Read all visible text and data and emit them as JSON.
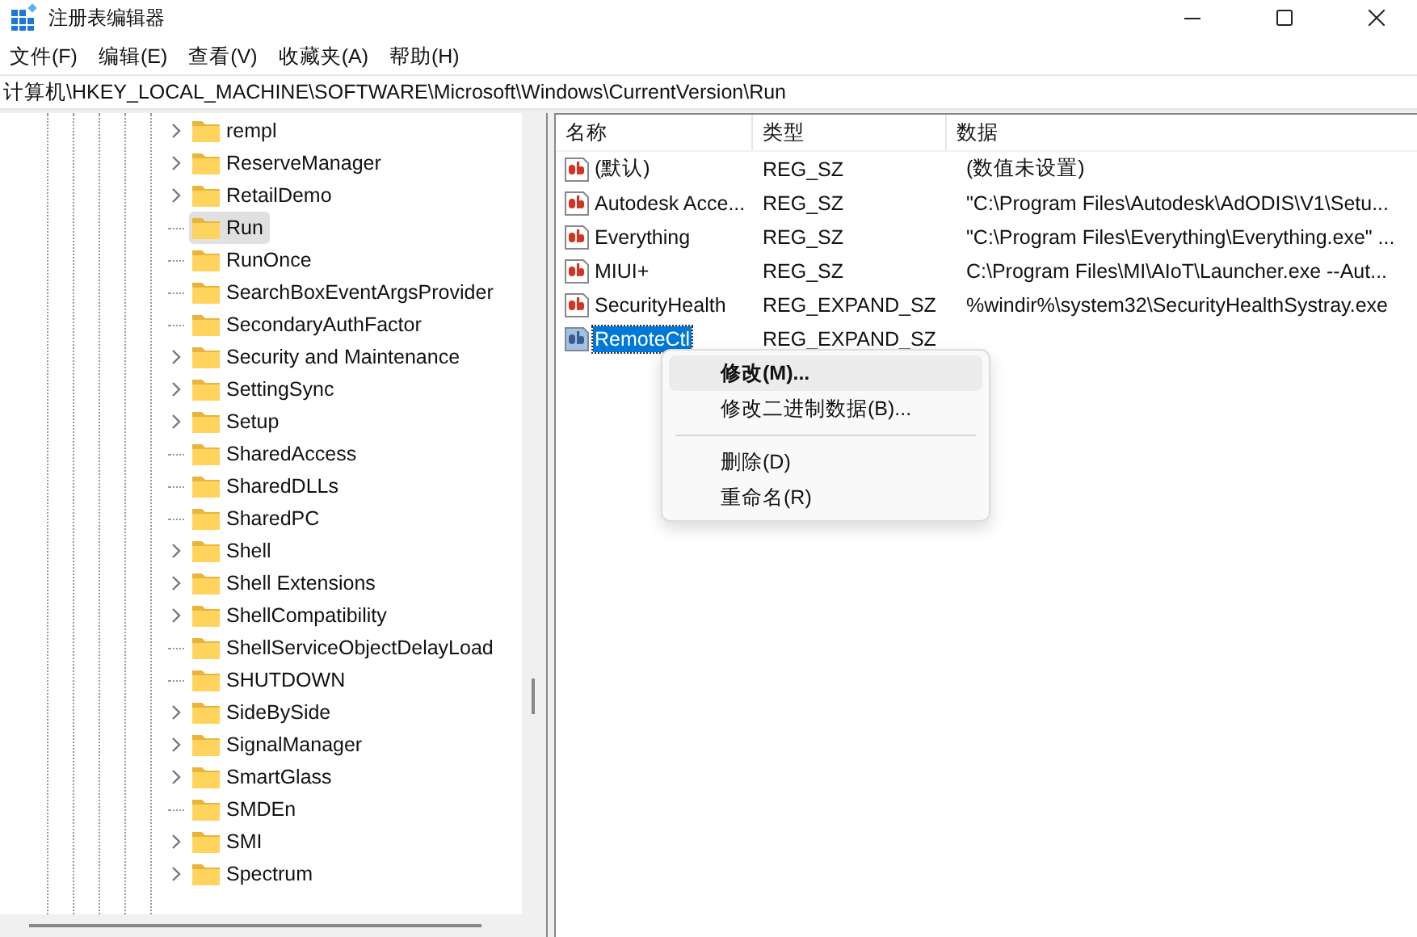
{
  "window": {
    "title": "注册表编辑器"
  },
  "menu": [
    "文件(F)",
    "编辑(E)",
    "查看(V)",
    "收藏夹(A)",
    "帮助(H)"
  ],
  "address": "计算机\\HKEY_LOCAL_MACHINE\\SOFTWARE\\Microsoft\\Windows\\CurrentVersion\\Run",
  "tree": [
    {
      "label": "rempl",
      "has_children": true,
      "selected": false
    },
    {
      "label": "ReserveManager",
      "has_children": true,
      "selected": false
    },
    {
      "label": "RetailDemo",
      "has_children": true,
      "selected": false
    },
    {
      "label": "Run",
      "has_children": false,
      "selected": true
    },
    {
      "label": "RunOnce",
      "has_children": false,
      "selected": false
    },
    {
      "label": "SearchBoxEventArgsProvider",
      "has_children": false,
      "selected": false
    },
    {
      "label": "SecondaryAuthFactor",
      "has_children": false,
      "selected": false
    },
    {
      "label": "Security and Maintenance",
      "has_children": true,
      "selected": false
    },
    {
      "label": "SettingSync",
      "has_children": true,
      "selected": false
    },
    {
      "label": "Setup",
      "has_children": true,
      "selected": false
    },
    {
      "label": "SharedAccess",
      "has_children": false,
      "selected": false
    },
    {
      "label": "SharedDLLs",
      "has_children": false,
      "selected": false
    },
    {
      "label": "SharedPC",
      "has_children": false,
      "selected": false
    },
    {
      "label": "Shell",
      "has_children": true,
      "selected": false
    },
    {
      "label": "Shell Extensions",
      "has_children": true,
      "selected": false
    },
    {
      "label": "ShellCompatibility",
      "has_children": true,
      "selected": false
    },
    {
      "label": "ShellServiceObjectDelayLoad",
      "has_children": false,
      "selected": false
    },
    {
      "label": "SHUTDOWN",
      "has_children": false,
      "selected": false
    },
    {
      "label": "SideBySide",
      "has_children": true,
      "selected": false
    },
    {
      "label": "SignalManager",
      "has_children": true,
      "selected": false
    },
    {
      "label": "SmartGlass",
      "has_children": true,
      "selected": false
    },
    {
      "label": "SMDEn",
      "has_children": false,
      "selected": false
    },
    {
      "label": "SMI",
      "has_children": true,
      "selected": false
    },
    {
      "label": "Spectrum",
      "has_children": true,
      "selected": false
    }
  ],
  "table": {
    "columns": [
      "名称",
      "类型",
      "数据"
    ],
    "rows": [
      {
        "name": "(默认)",
        "type": "REG_SZ",
        "data": "(数值未设置)",
        "selected": false
      },
      {
        "name": "Autodesk Acce...",
        "type": "REG_SZ",
        "data": "\"C:\\Program Files\\Autodesk\\AdODIS\\V1\\Setu...",
        "selected": false
      },
      {
        "name": "Everything",
        "type": "REG_SZ",
        "data": "\"C:\\Program Files\\Everything\\Everything.exe\" ...",
        "selected": false
      },
      {
        "name": "MIUI+",
        "type": "REG_SZ",
        "data": "C:\\Program Files\\MI\\AIoT\\Launcher.exe --Aut...",
        "selected": false
      },
      {
        "name": "SecurityHealth",
        "type": "REG_EXPAND_SZ",
        "data": "%windir%\\system32\\SecurityHealthSystray.exe",
        "selected": false
      },
      {
        "name": "RemoteCtl",
        "type": "REG_EXPAND_SZ",
        "selected": true
      }
    ]
  },
  "context_menu": [
    {
      "kind": "item",
      "label": "修改(M)...",
      "default": true,
      "highlighted": true
    },
    {
      "kind": "item",
      "label": "修改二进制数据(B)...",
      "default": false,
      "highlighted": false
    },
    {
      "kind": "separator"
    },
    {
      "kind": "item",
      "label": "删除(D)",
      "default": false,
      "highlighted": false
    },
    {
      "kind": "item",
      "label": "重命名(R)",
      "default": false,
      "highlighted": false
    }
  ]
}
